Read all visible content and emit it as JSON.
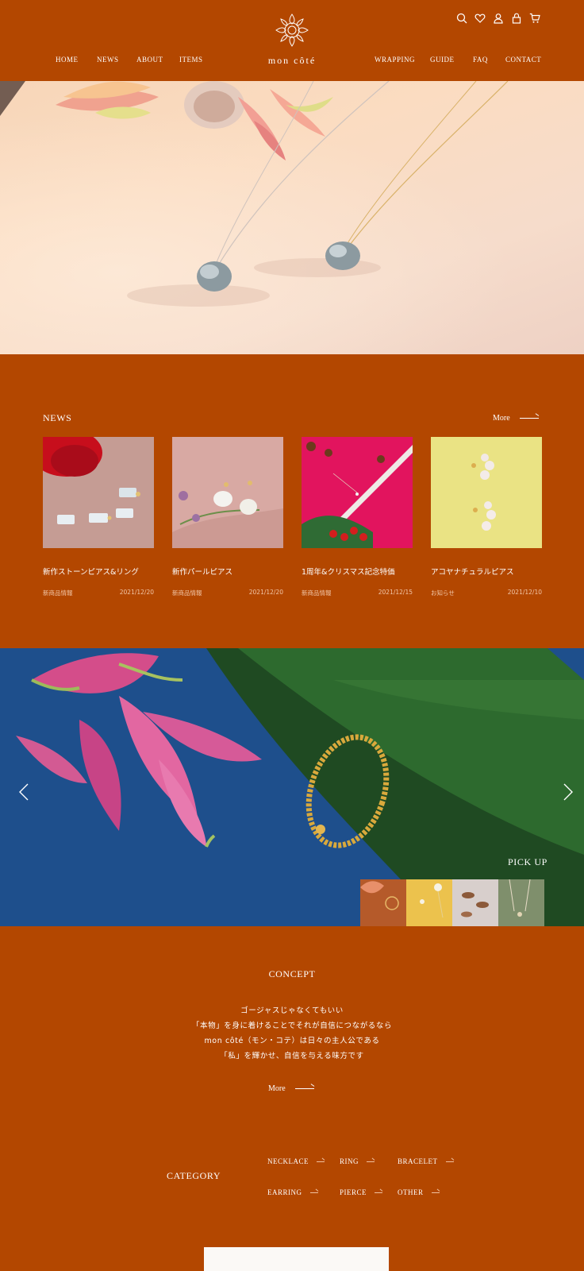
{
  "header": {
    "brand": "mon côté",
    "nav_left": [
      {
        "label": "HOME"
      },
      {
        "label": "NEWS"
      },
      {
        "label": "ABOUT"
      },
      {
        "label": "ITEMS"
      }
    ],
    "nav_right": [
      {
        "label": "WRAPPING"
      },
      {
        "label": "GUIDE"
      },
      {
        "label": "FAQ"
      },
      {
        "label": "CONTACT"
      }
    ],
    "icons": [
      "search-icon",
      "heart-icon",
      "user-icon",
      "lock-icon",
      "cart-icon"
    ]
  },
  "hero": {
    "image": "pearl-necklaces-photo"
  },
  "news": {
    "title": "NEWS",
    "more_label": "More",
    "items": [
      {
        "title": "新作ストーンピアス&リング",
        "category": "新商品情報",
        "date": "2021/12/20"
      },
      {
        "title": "新作パールピアス",
        "category": "新商品情報",
        "date": "2021/12/20"
      },
      {
        "title": "1周年&クリスマス記念特価",
        "category": "新商品情報",
        "date": "2021/12/15"
      },
      {
        "title": "アコヤナチュラルピアス",
        "category": "お知らせ",
        "date": "2021/12/10"
      }
    ]
  },
  "pickup": {
    "label": "PICK UP"
  },
  "concept": {
    "title": "CONCEPT",
    "lines": [
      "ゴージャスじゃなくてもいい",
      "「本物」を身に着けることでそれが自信につながるなら",
      "mon côté（モン・コテ）は日々の主人公である",
      "「私」を輝かせ、自信を与える味方です"
    ],
    "more_label": "More"
  },
  "category": {
    "title": "CATEGORY",
    "items": [
      {
        "label": "NECKLACE"
      },
      {
        "label": "RING"
      },
      {
        "label": "BRACELET"
      },
      {
        "label": "EARRING"
      },
      {
        "label": "PIERCE"
      },
      {
        "label": "OTHER"
      }
    ]
  },
  "colors": {
    "brand": "#b34700",
    "text": "#ffffff",
    "muted": "#f2c7a8"
  }
}
